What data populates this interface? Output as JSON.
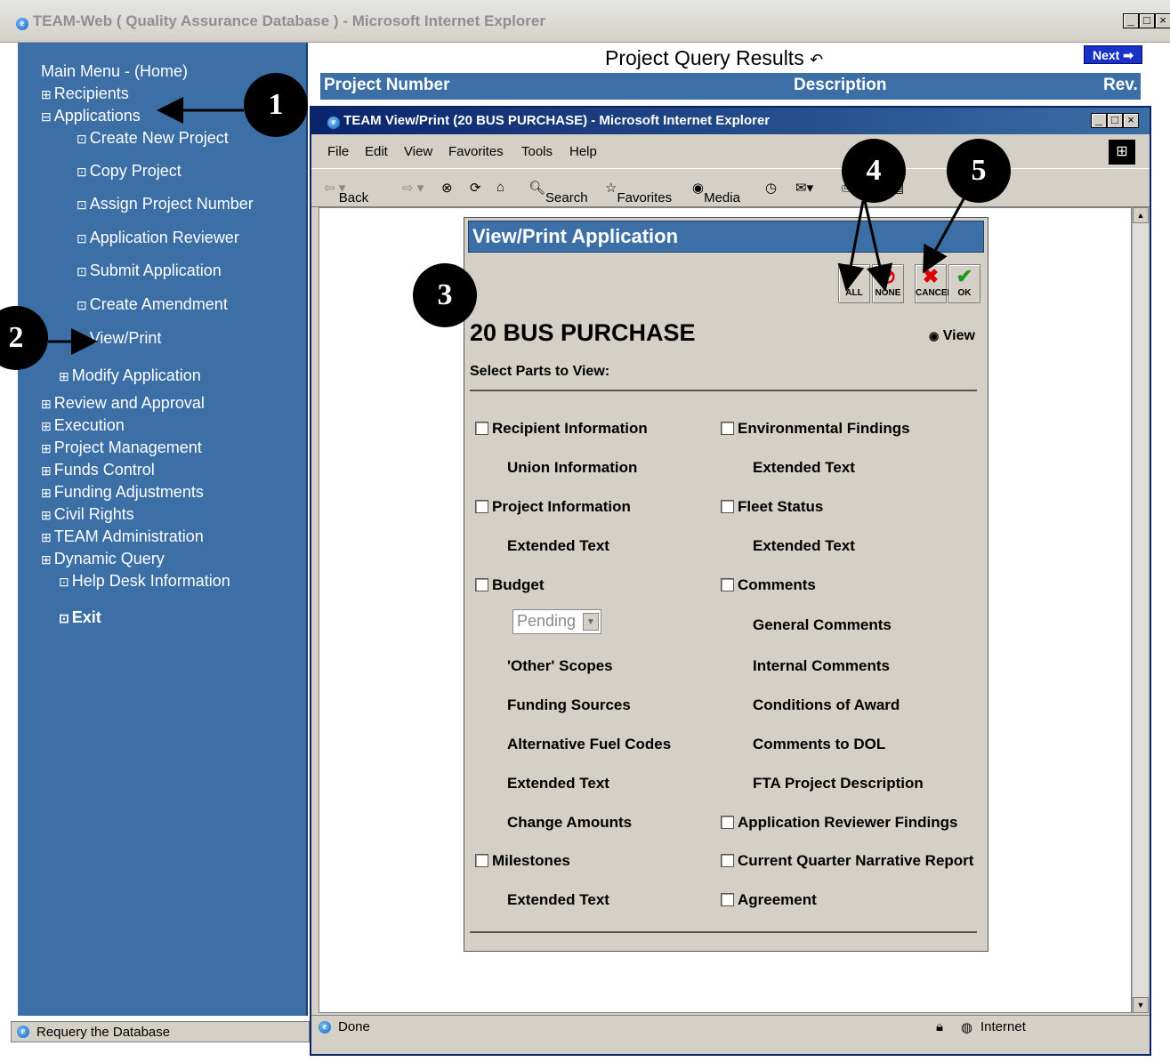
{
  "outer_window": {
    "title": "TEAM-Web ( Quality Assurance Database ) - Microsoft Internet Explorer",
    "status": "Requery the Database"
  },
  "nav": {
    "home": "Main Menu - (Home)",
    "recipients": "Recipients",
    "applications": "Applications",
    "create_new_project": "Create New Project",
    "copy_project": "Copy Project",
    "assign_project_number": "Assign Project Number",
    "application_reviewer": "Application Reviewer",
    "submit_application": "Submit Application",
    "create_amendment": "Create Amendment",
    "view_print": "View/Print",
    "modify_application": "Modify Application",
    "review_and_approval": "Review and Approval",
    "execution": "Execution",
    "project_management": "Project Management",
    "funds_control": "Funds Control",
    "funding_adjustments": "Funding Adjustments",
    "civil_rights": "Civil Rights",
    "team_administration": "TEAM Administration",
    "dynamic_query": "Dynamic Query",
    "help_desk": "Help Desk Information",
    "exit": "Exit"
  },
  "results": {
    "title": "Project Query Results",
    "next_label": "Next",
    "col_project_number": "Project Number",
    "col_description": "Description",
    "col_rev": "Rev."
  },
  "inner_window": {
    "title": "TEAM View/Print (20 BUS PURCHASE) - Microsoft Internet Explorer",
    "menu": [
      "File",
      "Edit",
      "View",
      "Favorites",
      "Tools",
      "Help"
    ],
    "toolbar": {
      "back": "Back",
      "search": "Search",
      "favorites": "Favorites",
      "media": "Media"
    },
    "status_left": "Done",
    "status_zone": "Internet"
  },
  "panel": {
    "header": "View/Print Application",
    "btn_all": "ALL",
    "btn_none": "NONE",
    "btn_cancel": "CANCEL",
    "btn_ok": "OK",
    "project_name": "20 BUS PURCHASE",
    "view_radio": "View",
    "select_label": "Select Parts to View:",
    "budget_select_value": "Pending",
    "left_parts": {
      "recipient_information": "Recipient Information",
      "union_information": "Union Information",
      "project_information": "Project Information",
      "project_extended_text": "Extended Text",
      "budget": "Budget",
      "other_scopes": "'Other' Scopes",
      "funding_sources": "Funding Sources",
      "alternative_fuel_codes": "Alternative Fuel Codes",
      "budget_extended_text": "Extended Text",
      "change_amounts": "Change Amounts",
      "milestones": "Milestones",
      "milestones_extended_text": "Extended Text"
    },
    "right_parts": {
      "environmental_findings": "Environmental Findings",
      "env_extended_text": "Extended Text",
      "fleet_status": "Fleet Status",
      "fleet_extended_text": "Extended Text",
      "comments": "Comments",
      "general_comments": "General Comments",
      "internal_comments": "Internal Comments",
      "conditions_of_award": "Conditions of Award",
      "comments_to_dol": "Comments to DOL",
      "fta_project_description": "FTA Project Description",
      "application_reviewer_findings": "Application Reviewer Findings",
      "current_quarter_narrative_report": "Current Quarter Narrative Report",
      "agreement": "Agreement"
    }
  },
  "callouts": [
    "1",
    "2",
    "3",
    "4",
    "5"
  ]
}
